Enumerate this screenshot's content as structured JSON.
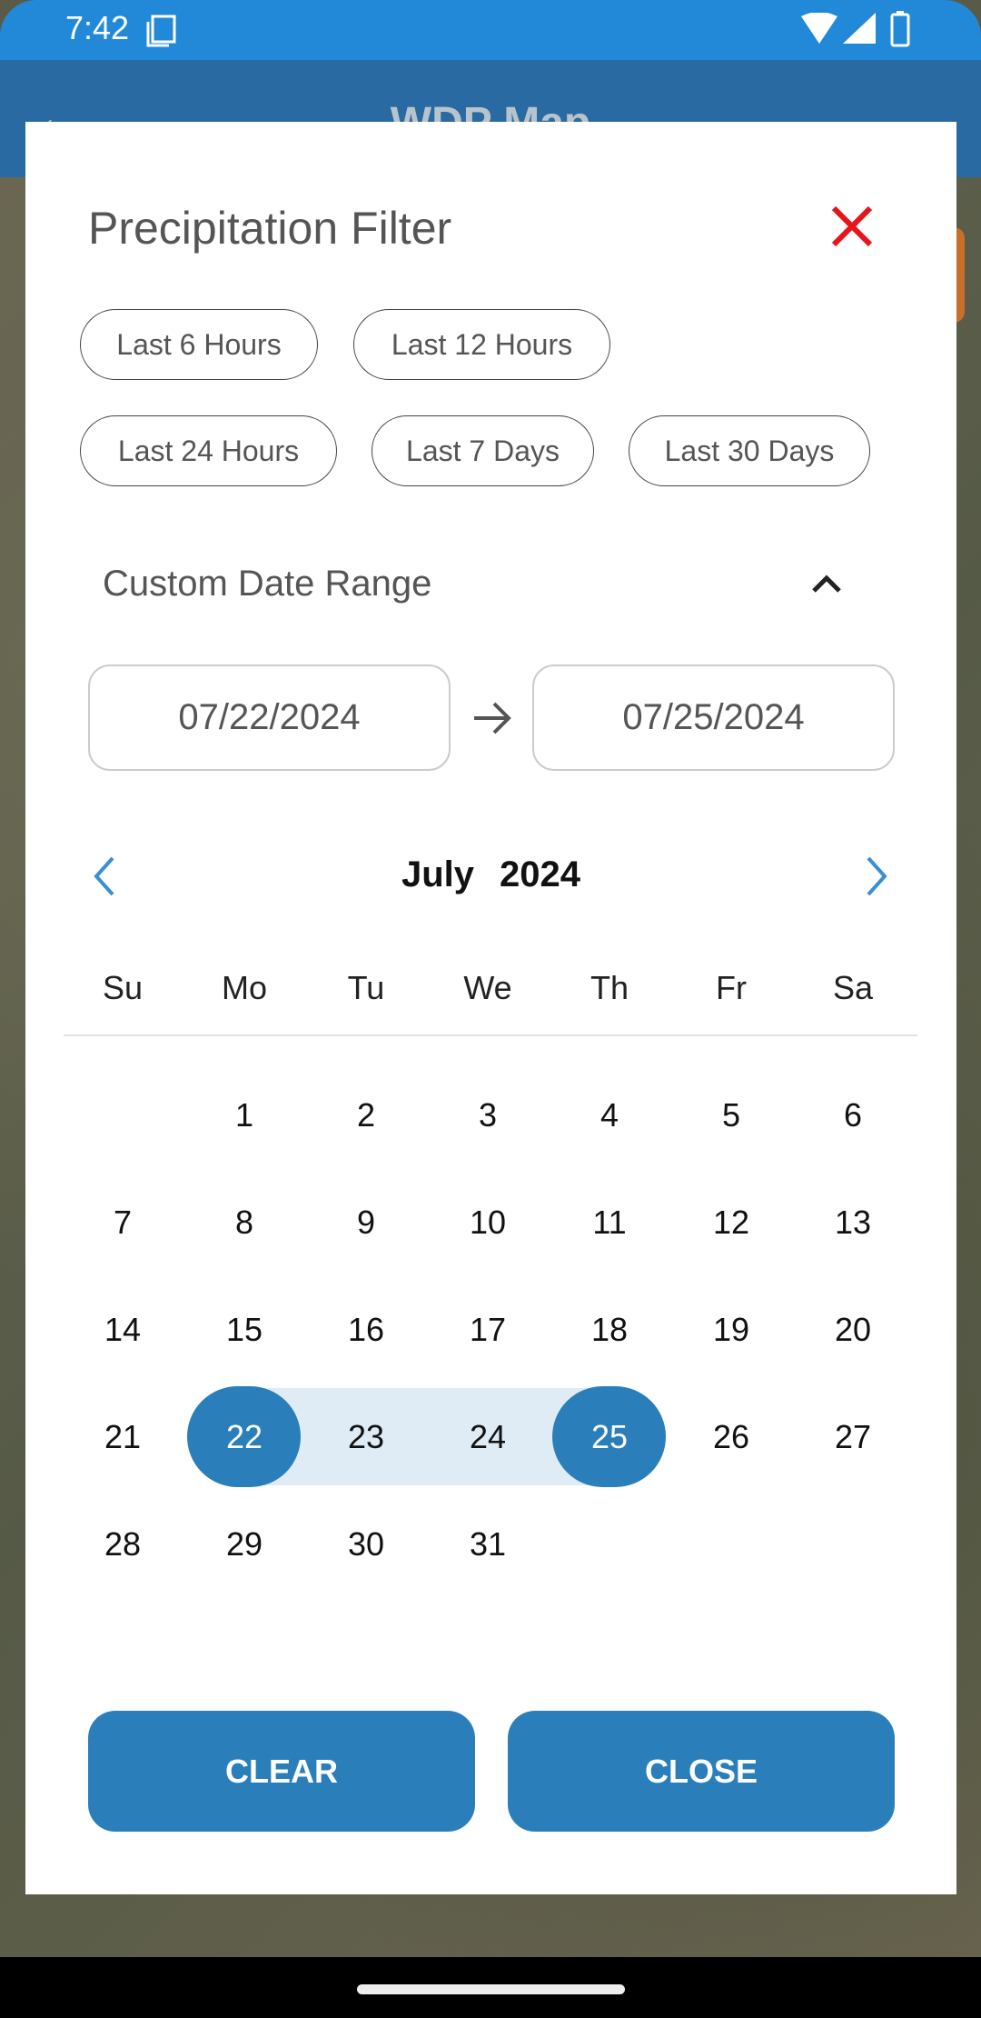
{
  "status_bar": {
    "time": "7:42"
  },
  "app_bar": {
    "title": "WDP Map"
  },
  "dialog": {
    "title": "Precipitation Filter",
    "chips": [
      "Last 6 Hours",
      "Last 12 Hours",
      "Last 24 Hours",
      "Last 7 Days",
      "Last 30 Days"
    ],
    "custom_range_label": "Custom Date Range",
    "start_date": "07/22/2024",
    "end_date": "07/25/2024",
    "calendar": {
      "month": "July",
      "year": "2024",
      "weekdays": [
        "Su",
        "Mo",
        "Tu",
        "We",
        "Th",
        "Fr",
        "Sa"
      ],
      "first_weekday_index": 1,
      "days_in_month": 31,
      "range_start": 22,
      "range_end": 25
    },
    "buttons": {
      "clear": "CLEAR",
      "close": "CLOSE"
    }
  },
  "colors": {
    "accent": "#2a7fba",
    "range_fill": "#dfebf5",
    "close_icon": "#e8141c",
    "status_bar": "#2289d9",
    "app_bar": "#2a6aa2"
  }
}
